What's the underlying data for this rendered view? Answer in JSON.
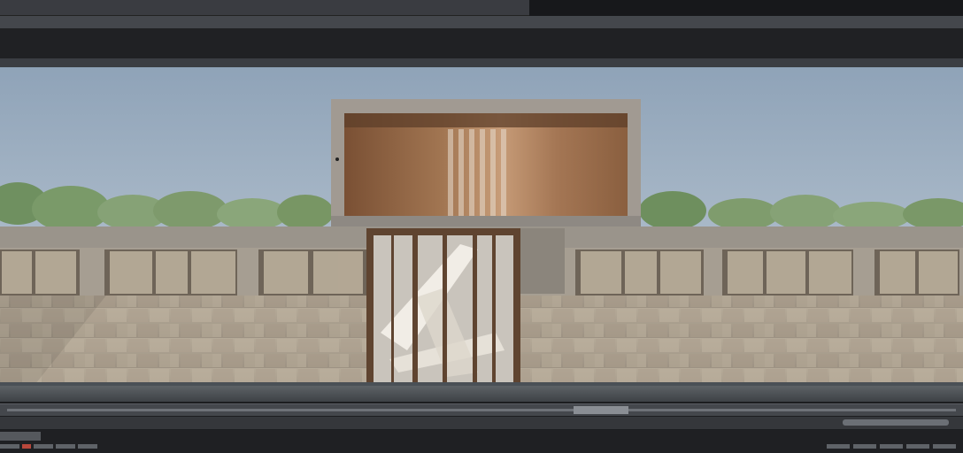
{
  "window": {
    "title": ""
  },
  "toolbar": {
    "swatches": [
      "#5b7fc2",
      "#6aa0d6",
      "#8fbad9",
      "#4a6fa5",
      "#72a0a8",
      "#a8c3d8",
      "#5d8ec0",
      "#7db4e0",
      "#c28a4b",
      "#e3b85a",
      "#6c9fd1",
      "#3d79c2",
      "#9bb7cf",
      "#6a8aa7",
      "#88b0cc",
      "#4f7fb6",
      "#c9d7e2",
      "#5a8cc4",
      "#7ba6c9",
      "#a1bdd4",
      "#3b6ea6",
      "#6f98bf",
      "#8cb3d6",
      "#4c80bd",
      "#b3c8d9"
    ],
    "accent_color": "#4f9ad4"
  },
  "scene": {
    "sky_color": "#a6b6c6",
    "wall_color": "#b8ab98",
    "wood_color": "#8a5f3f",
    "tree_color": "#6f9060"
  },
  "status": {}
}
